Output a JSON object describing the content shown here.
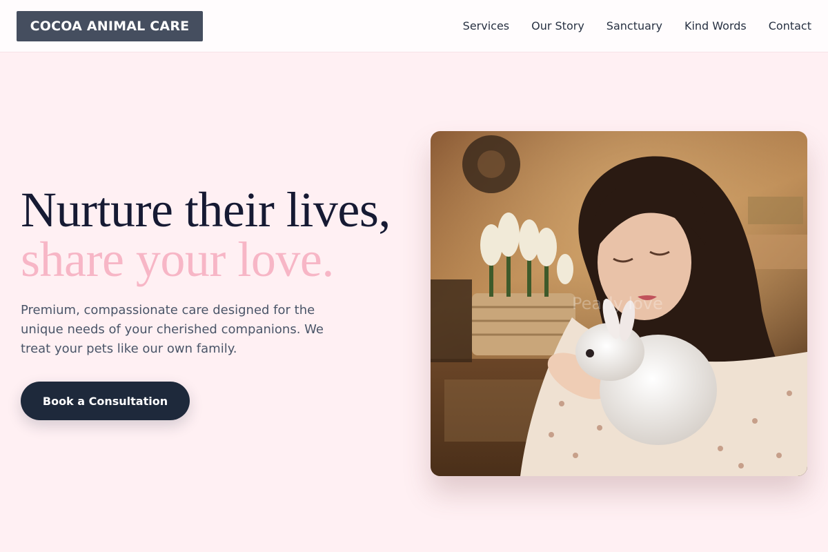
{
  "header": {
    "logo": "COCOA ANIMAL CARE",
    "nav": [
      "Services",
      "Our Story",
      "Sanctuary",
      "Kind Words",
      "Contact"
    ]
  },
  "hero": {
    "headline_line1": "Nurture their lives,",
    "headline_line2": "share your love.",
    "description": "Premium, compassionate care designed for the unique needs of your cherished companions. We treat your pets like our own family.",
    "cta_label": "Book a Consultation"
  },
  "colors": {
    "background": "#fff0f3",
    "headline_dark": "#161a33",
    "headline_accent": "#f7b6c6",
    "button": "#1e293b",
    "logo_bg": "#454e5f"
  },
  "photo": {
    "subject": "woman holding a white rabbit",
    "watermark": "Pearly love"
  }
}
